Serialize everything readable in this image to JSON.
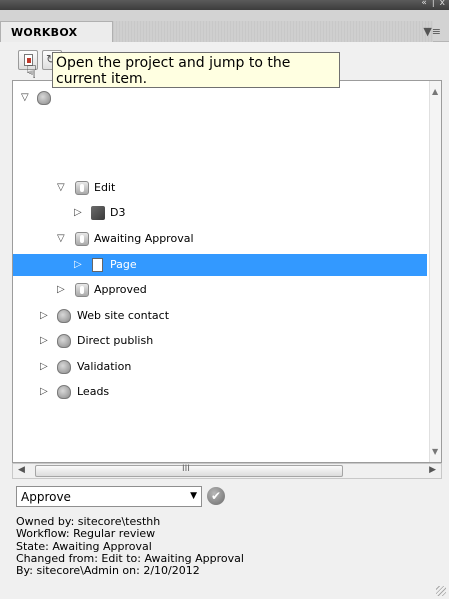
{
  "window": {
    "controls": "« | x"
  },
  "panel": {
    "title": "WORKBOX",
    "menu_icon": "panel-menu-icon"
  },
  "toolbar": {
    "buttons": [
      {
        "icon": "open-project-icon"
      },
      {
        "icon": "refresh-icon"
      }
    ]
  },
  "tooltip": {
    "text": "Open the project and jump to the current item."
  },
  "tree": {
    "items": [
      {
        "label": "",
        "icon": "workflow-icon",
        "expanded": true
      },
      {
        "label": "Edit",
        "icon": "state-icon",
        "expanded": true
      },
      {
        "label": "D3",
        "icon": "item-3d-icon",
        "expanded": false
      },
      {
        "label": "Awaiting Approval",
        "icon": "state-icon",
        "expanded": true
      },
      {
        "label": "Page",
        "icon": "page-icon",
        "expanded": false,
        "selected": true
      },
      {
        "label": "Approved",
        "icon": "state-icon",
        "expanded": false
      },
      {
        "label": "Web site contact",
        "icon": "workflow-icon",
        "expanded": false
      },
      {
        "label": "Direct publish",
        "icon": "workflow-icon",
        "expanded": false
      },
      {
        "label": "Validation",
        "icon": "workflow-icon",
        "expanded": false
      },
      {
        "label": "Leads",
        "icon": "workflow-icon",
        "expanded": false
      }
    ]
  },
  "scrollbar": {
    "grip": "III"
  },
  "command": {
    "selected": "Approve",
    "go_icon": "approve-check-icon"
  },
  "details": {
    "owned_by": "Owned by: sitecore\\testhh",
    "workflow": "Workflow: Regular review",
    "state": "State: Awaiting Approval",
    "changed": "Changed from: Edit to: Awaiting Approval",
    "by": "By: sitecore\\Admin on: 2/10/2012"
  },
  "colors": {
    "selection": "#3399ff",
    "tooltip_bg": "#ffffe1",
    "tab_bar": "#d3d3d3"
  }
}
